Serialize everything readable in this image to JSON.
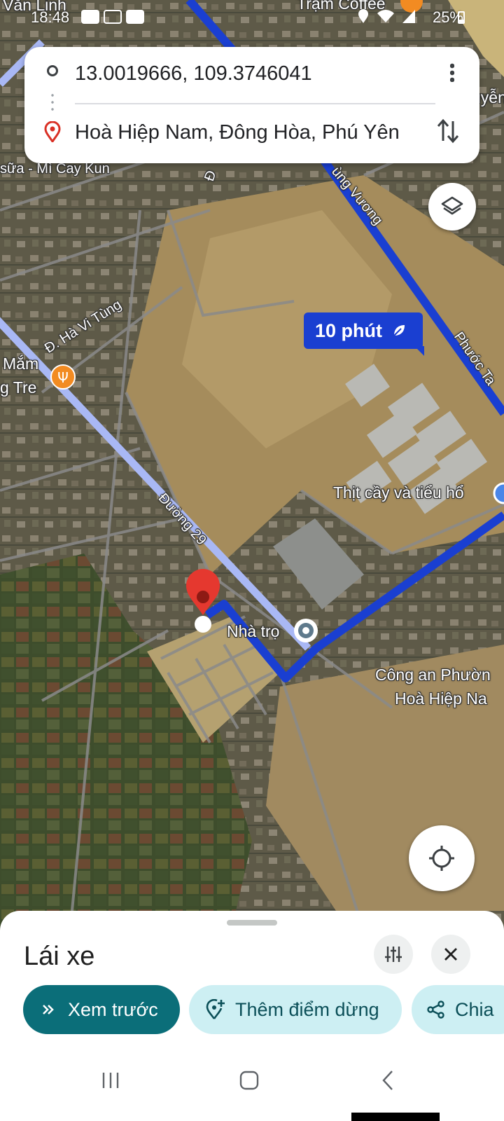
{
  "status_bar": {
    "time": "18:48",
    "battery": "25%"
  },
  "directions": {
    "origin": "13.0019666, 109.3746041",
    "destination": "Hoà Hiệp Nam, Đông Hòa, Phú Yên"
  },
  "map": {
    "eta_label": "10 phút",
    "labels": {
      "van_linh": "Văn Linh",
      "tram_coffee": "Trạm Coffee",
      "nguyen": "uyễn",
      "mi_cay": "sữa - Mì Cay Kun",
      "hung_vuong": "ùng Vương",
      "ha_vi_tung": "Đ. Hà Vi Tùng",
      "mam": "Mắm",
      "tre": "g Tre",
      "phuoc_ta": "Phước Ta",
      "thit_cay": "Thịt cầy và tiểu hổ",
      "duong_29": "Đường 29",
      "nha_tro": "Nhà trọ",
      "cong_an_1": "Công an Phườn",
      "cong_an_2": "Hoà Hiệp Na",
      "d_label": "Đ"
    }
  },
  "sheet": {
    "mode_label": "Lái xe",
    "preview_label": "Xem trước",
    "add_stop_label": "Thêm điểm dừng",
    "share_label": "Chia"
  },
  "icons": {
    "origin": "circle-outline-icon",
    "destination": "location-pin-icon",
    "more": "more-vert-icon",
    "swap": "swap-vert-icon",
    "layers": "layers-icon",
    "my_location": "my-location-icon",
    "options": "tune-icon",
    "close": "close-icon"
  },
  "colors": {
    "route": "#1a3fd1",
    "route_alt": "#a9b8f5",
    "pin": "#e5382f",
    "accent": "#0b6e79"
  }
}
